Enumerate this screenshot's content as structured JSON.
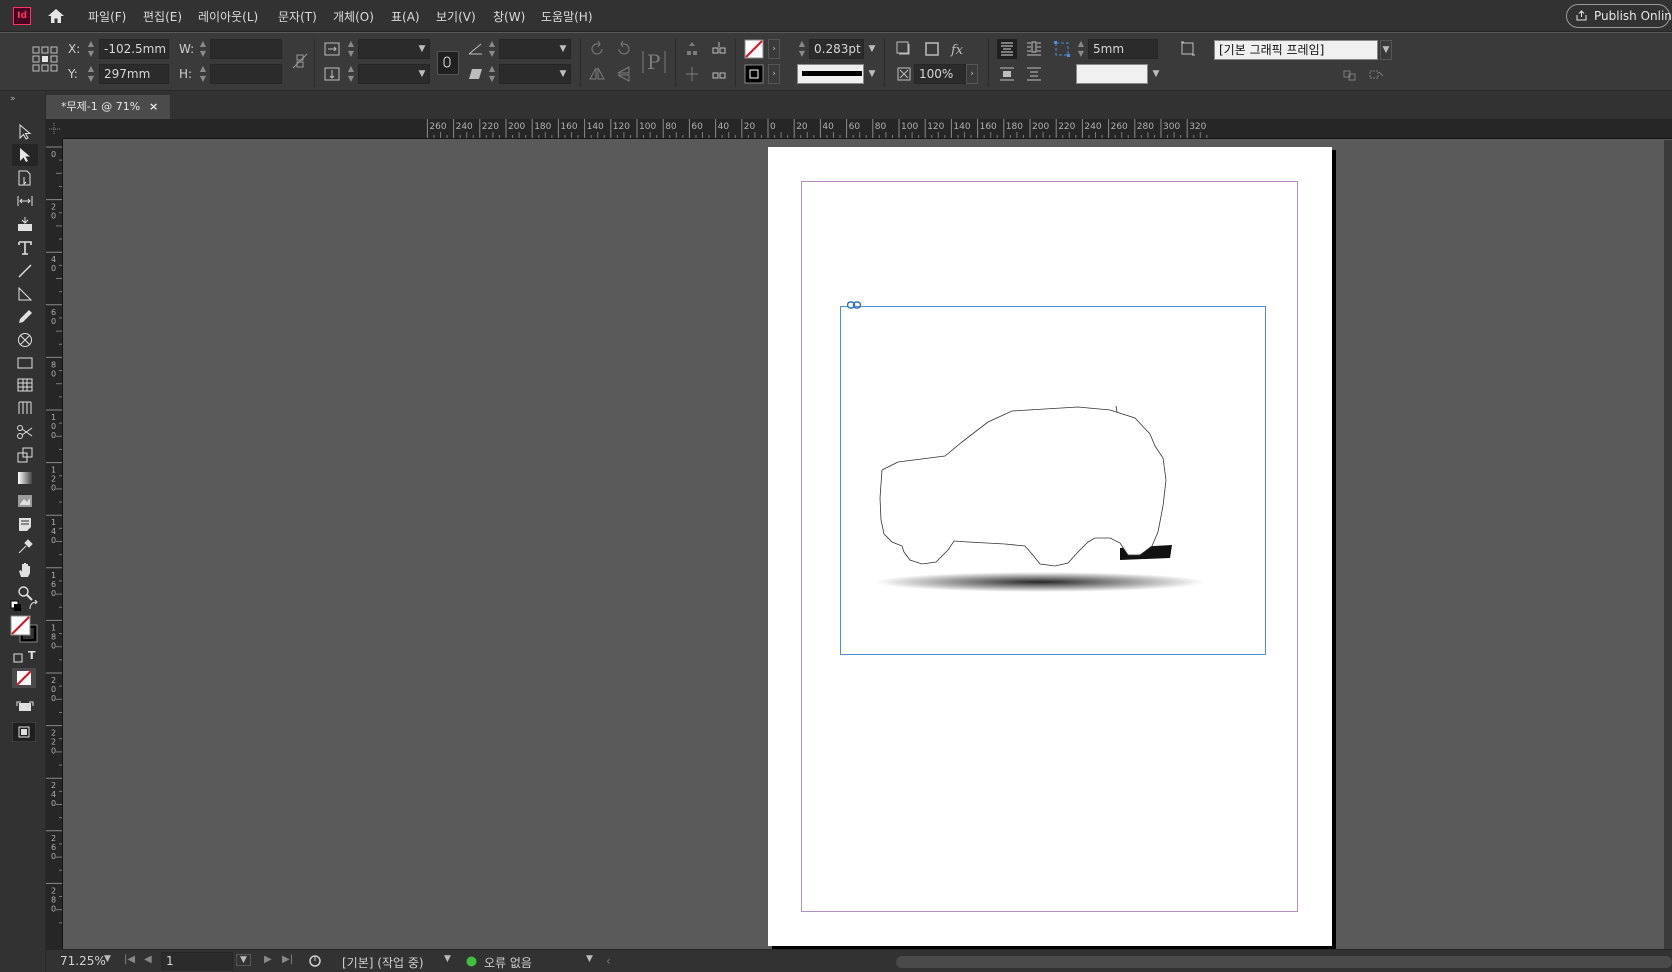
{
  "app": {
    "logo_text": "Id"
  },
  "menu": [
    "파일(F)",
    "편집(E)",
    "레이아웃(L)",
    "문자(T)",
    "개체(O)",
    "표(A)",
    "보기(V)",
    "창(W)",
    "도움말(H)"
  ],
  "publish_label": "Publish Online",
  "control": {
    "x_label": "X:",
    "x_value": "-102.5mm",
    "y_label": "Y:",
    "y_value": "297mm",
    "w_label": "W:",
    "h_label": "H:",
    "stroke_weight": "0.283pt",
    "opacity": "100%",
    "spacing_value": "5mm",
    "object_style": "[기본 그래픽 프레임]"
  },
  "tab": {
    "title": "*무제-1 @ 71%",
    "close": "×"
  },
  "ruler_top": [
    "260",
    "240",
    "220",
    "200",
    "180",
    "160",
    "140",
    "120",
    "100",
    "80",
    "60",
    "40",
    "20",
    "0",
    "20",
    "40",
    "60",
    "80",
    "100",
    "120",
    "140",
    "160",
    "180",
    "200",
    "220",
    "240",
    "260",
    "280",
    "300",
    "320"
  ],
  "ruler_left": [
    "0",
    "20",
    "40",
    "60",
    "80",
    "100",
    "120",
    "140",
    "160",
    "180",
    "200",
    "220",
    "240",
    "260",
    "280"
  ],
  "status": {
    "zoom": "71.25%",
    "page": "1",
    "mode": "[기본] (작업 중)",
    "errors": "오류 없음"
  },
  "colors": {
    "accent_frame": "#4f8ed4",
    "margin_guide": "#b48cc8",
    "status_ok": "#3fbf3f",
    "logo": "#ff3366"
  },
  "tools": [
    "selection-tool",
    "direct-selection-tool",
    "page-tool",
    "gap-tool",
    "content-collector-tool",
    "type-tool",
    "line-tool",
    "pen-tool",
    "pencil-tool",
    "frame-tool",
    "rectangle-tool",
    "table-tool",
    "grid-tool",
    "scissors-tool",
    "free-transform-tool",
    "gradient-tool",
    "gradient-feather-tool",
    "note-tool",
    "eyedropper-tool",
    "hand-tool",
    "zoom-tool"
  ]
}
